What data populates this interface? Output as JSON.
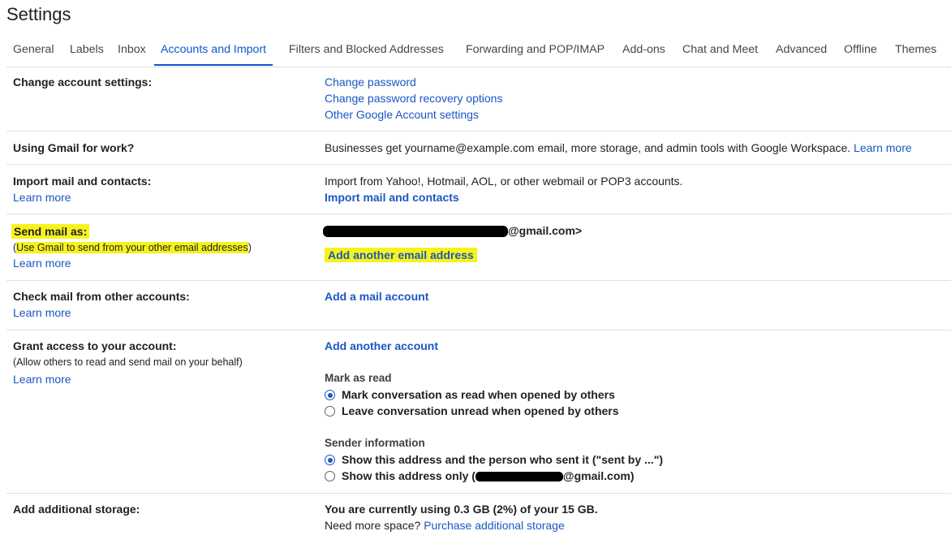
{
  "page_title": "Settings",
  "tabs": [
    "General",
    "Labels",
    "Inbox",
    "Accounts and Import",
    "Filters and Blocked Addresses",
    "Forwarding and POP/IMAP",
    "Add-ons",
    "Chat and Meet",
    "Advanced",
    "Offline",
    "Themes"
  ],
  "active_tab": "Accounts and Import",
  "colors": {
    "accent": "#0b57d0",
    "link": "#1a56c4",
    "highlight": "#f7f31a"
  },
  "change_account": {
    "label": "Change account settings:",
    "links": [
      "Change password",
      "Change password recovery options",
      "Other Google Account settings"
    ]
  },
  "gmail_work": {
    "label": "Using Gmail for work?",
    "text": "Businesses get yourname@example.com email, more storage, and admin tools with Google Workspace.",
    "learn_more": "Learn more"
  },
  "import_mail": {
    "label": "Import mail and contacts:",
    "learn_more": "Learn more",
    "text": "Import from Yahoo!, Hotmail, AOL, or other webmail or POP3 accounts.",
    "action": "Import mail and contacts"
  },
  "send_mail_as": {
    "label": "Send mail as:",
    "sub_open": "(",
    "sub_text": "Use Gmail to send from your other email addresses",
    "sub_close": ")",
    "learn_more": "Learn more",
    "address_suffix": "@gmail.com>",
    "action": "Add another email address"
  },
  "check_mail": {
    "label": "Check mail from other accounts:",
    "learn_more": "Learn more",
    "action": "Add a mail account"
  },
  "grant_access": {
    "label": "Grant access to your account:",
    "sub": "(Allow others to read and send mail on your behalf)",
    "learn_more": "Learn more",
    "action": "Add another account",
    "mark_as_read": {
      "heading": "Mark as read",
      "options": [
        "Mark conversation as read when opened by others",
        "Leave conversation unread when opened by others"
      ],
      "selected": 0
    },
    "sender_info": {
      "heading": "Sender information",
      "option1": "Show this address and the person who sent it (\"sent by ...\")",
      "option2_prefix": "Show this address only (",
      "option2_suffix": "@gmail.com)",
      "selected": 0
    }
  },
  "storage": {
    "label": "Add additional storage:",
    "usage": "You are currently using 0.3 GB (2%) of your 15 GB.",
    "need_more": "Need more space?",
    "action": "Purchase additional storage"
  }
}
